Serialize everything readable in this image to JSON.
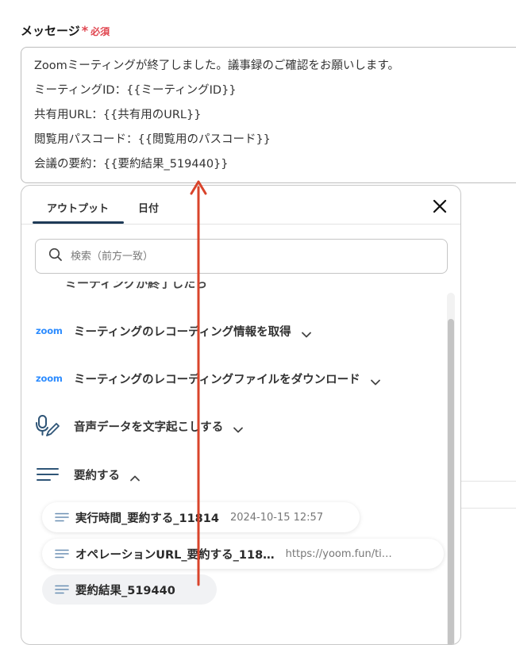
{
  "field": {
    "label": "メッセージ",
    "required_mark": "*",
    "required_text": "必須"
  },
  "message": {
    "lines": [
      "Zoomミーティングが終了しました。議事録のご確認をお願いします。",
      "ミーティングID：{{ミーティングID}}",
      "共有用URL：{{共有用のURL}}",
      "閲覧用パスコード：{{閲覧用のパスコード}}",
      "会議の要約：{{要約結果_519440}}"
    ]
  },
  "panel": {
    "tabs": [
      {
        "label": "アウトプット",
        "active": true
      },
      {
        "label": "日付",
        "active": false
      }
    ],
    "search_placeholder": "検索（前方一致）",
    "partial_header_text": "ミーティングが終了したら",
    "sections": [
      {
        "icon": "zoom-logo",
        "logo_text": "zoom",
        "label": "ミーティングのレコーディング情報を取得",
        "expanded": false
      },
      {
        "icon": "zoom-logo",
        "logo_text": "zoom",
        "label": "ミーティングのレコーディングファイルをダウンロード",
        "expanded": false
      },
      {
        "icon": "voice-transcribe-icon",
        "label": "音声データを文字起こしする",
        "expanded": false
      },
      {
        "icon": "summary-lines-icon",
        "label": "要約する",
        "expanded": true
      }
    ],
    "items": [
      {
        "name": "実行時間_要約する_11814",
        "value": "2024-10-15 12:57"
      },
      {
        "name": "オペレーションURL_要約する_118…",
        "value": "https://yoom.fun/ti…"
      },
      {
        "name": "要約結果_519440",
        "value": ""
      }
    ]
  },
  "colors": {
    "required": "#e0454f",
    "zoom": "#2d8cff",
    "tab_underline": "#1e3b57",
    "arrow": "#d9442b",
    "icon_blue": "#2f5577"
  }
}
